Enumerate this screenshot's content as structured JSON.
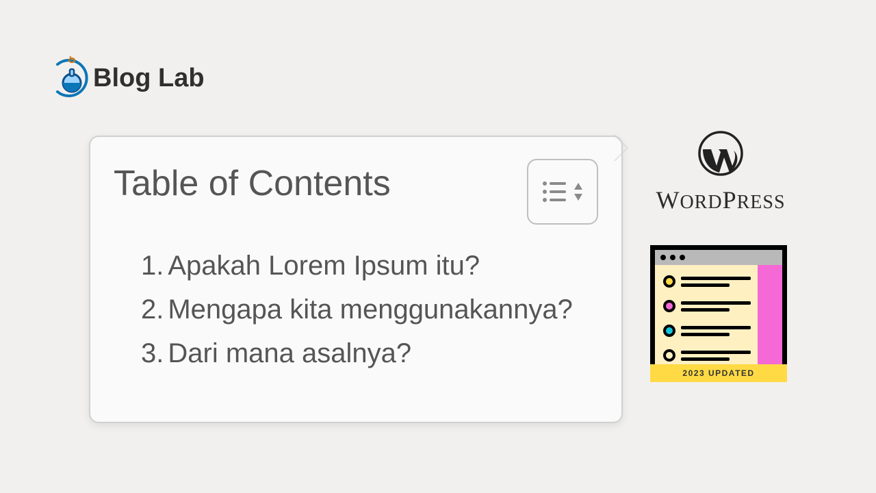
{
  "logo": {
    "text": "Blog Lab"
  },
  "toc": {
    "title": "Table of Contents",
    "items": [
      {
        "num": "1.",
        "text": "Apakah Lorem Ipsum itu?"
      },
      {
        "num": "2.",
        "text": "Mengapa kita menggunakannya?"
      },
      {
        "num": "3.",
        "text": "Dari mana asalnya?"
      }
    ]
  },
  "wordpress": {
    "text": "WORDPRESS"
  },
  "badge": {
    "text": "2023 UPDATED"
  }
}
